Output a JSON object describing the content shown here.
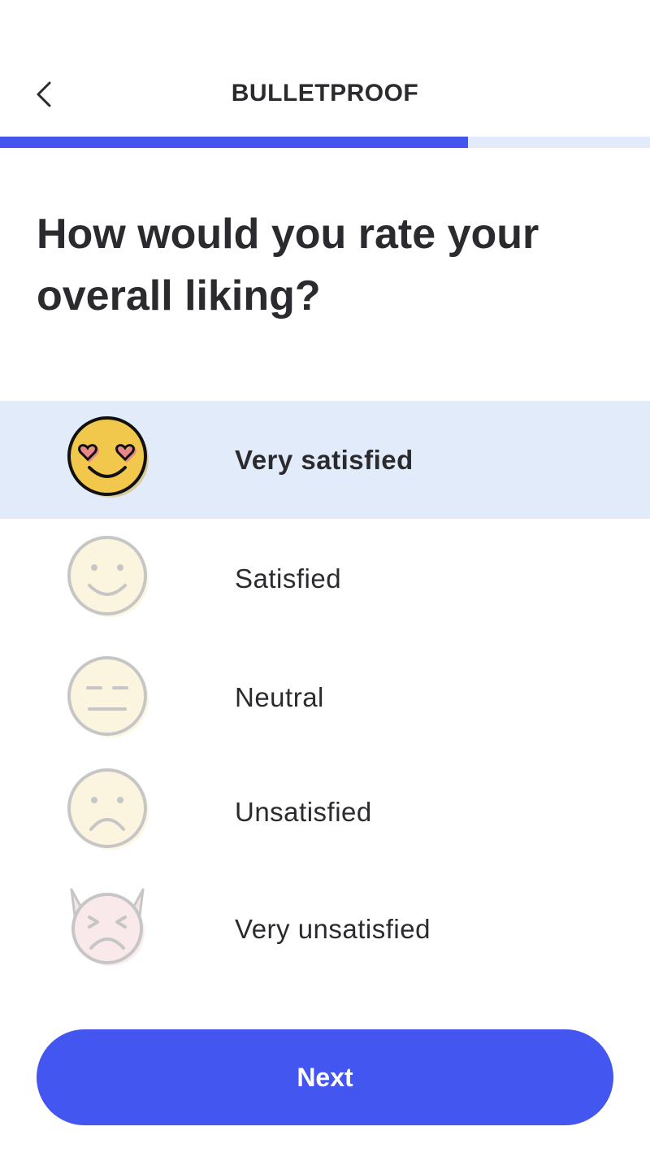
{
  "header": {
    "title": "BULLETPROOF"
  },
  "progress": {
    "fraction": 0.72
  },
  "question": "How would you rate your overall liking?",
  "options": [
    {
      "label": "Very satisfied",
      "icon": "heart-eyes-face-icon",
      "selected": true
    },
    {
      "label": "Satisfied",
      "icon": "smiling-face-icon",
      "selected": false
    },
    {
      "label": "Neutral",
      "icon": "neutral-face-icon",
      "selected": false
    },
    {
      "label": "Unsatisfied",
      "icon": "frowning-face-icon",
      "selected": false
    },
    {
      "label": "Very unsatisfied",
      "icon": "angry-devil-face-icon",
      "selected": false
    }
  ],
  "next_label": "Next",
  "colors": {
    "accent": "#4356f0",
    "selected_bg": "#e2ebfa",
    "progress_track": "#e3ebfa"
  }
}
